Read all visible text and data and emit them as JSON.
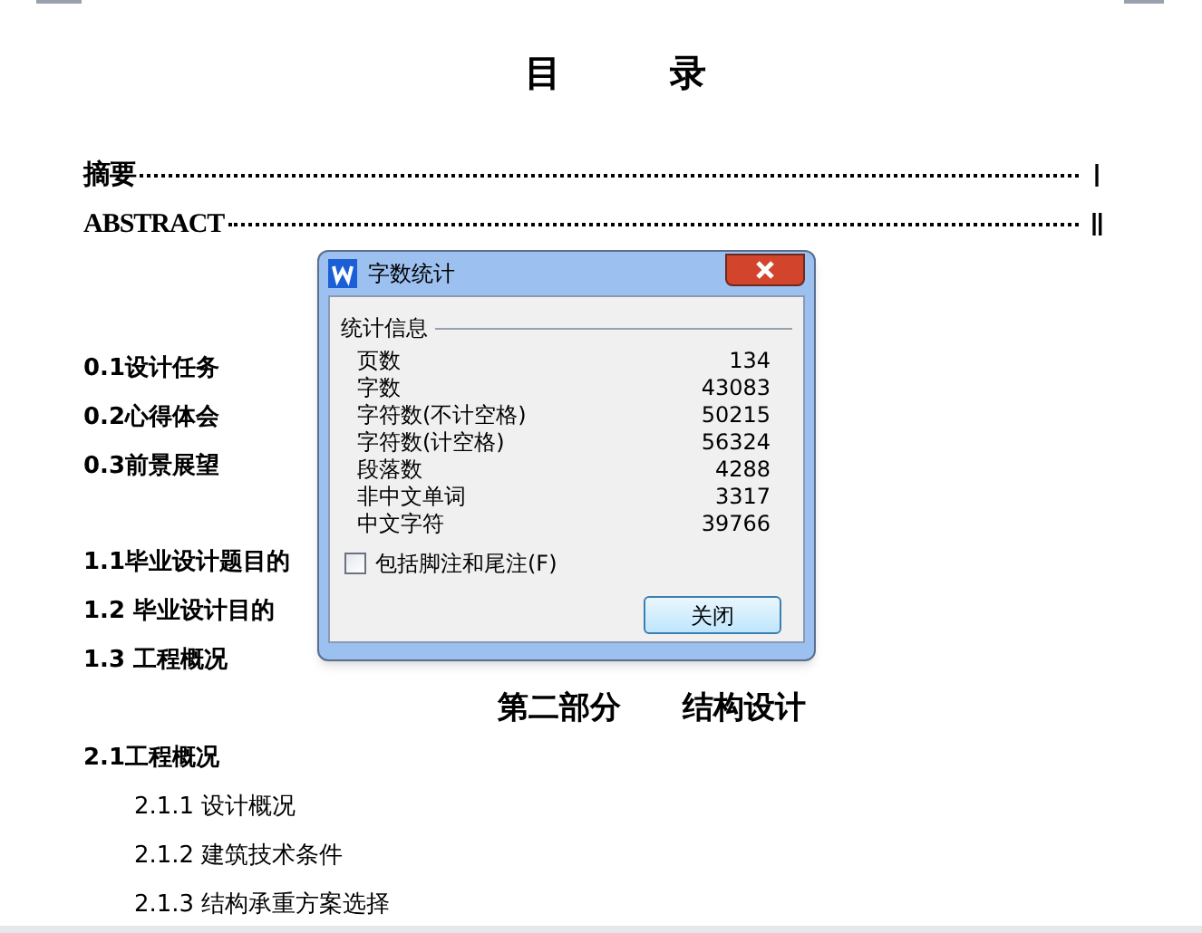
{
  "document": {
    "title": "目　　　录",
    "toc_groups": [
      {
        "entries": [
          {
            "kind": "dotted",
            "label": "摘要",
            "page": "Ⅰ"
          },
          {
            "kind": "dotted",
            "label": "ABSTRACT",
            "page": "Ⅱ"
          }
        ]
      },
      {
        "entries": [
          {
            "kind": "section",
            "label": "0.1设计任务"
          },
          {
            "kind": "section",
            "label": "0.2心得体会"
          },
          {
            "kind": "section",
            "label": "0.3前景展望"
          }
        ]
      },
      {
        "entries": [
          {
            "kind": "section",
            "label": "1.1毕业设计题目的"
          },
          {
            "kind": "section",
            "label": "1.2 毕业设计目的"
          },
          {
            "kind": "section",
            "label": "1.3 工程概况"
          },
          {
            "kind": "part",
            "label": "第二部分　　结构设计"
          },
          {
            "kind": "section",
            "label": "2.1工程概况"
          },
          {
            "kind": "sub",
            "label": "2.1.1 设计概况"
          },
          {
            "kind": "sub",
            "label": "2.1.2 建筑技术条件"
          },
          {
            "kind": "sub",
            "label": "2.1.3 结构承重方案选择"
          }
        ]
      }
    ]
  },
  "dialog": {
    "title": "字数统计",
    "group_label": "统计信息",
    "stats": [
      {
        "label": "页数",
        "value": "134"
      },
      {
        "label": "字数",
        "value": "43083"
      },
      {
        "label": "字符数(不计空格)",
        "value": "50215"
      },
      {
        "label": "字符数(计空格)",
        "value": "56324"
      },
      {
        "label": "段落数",
        "value": "4288"
      },
      {
        "label": "非中文单词",
        "value": "3317"
      },
      {
        "label": "中文字符",
        "value": "39766"
      }
    ],
    "checkbox": {
      "label": "包括脚注和尾注(F)",
      "checked": false
    },
    "button": "关闭"
  }
}
